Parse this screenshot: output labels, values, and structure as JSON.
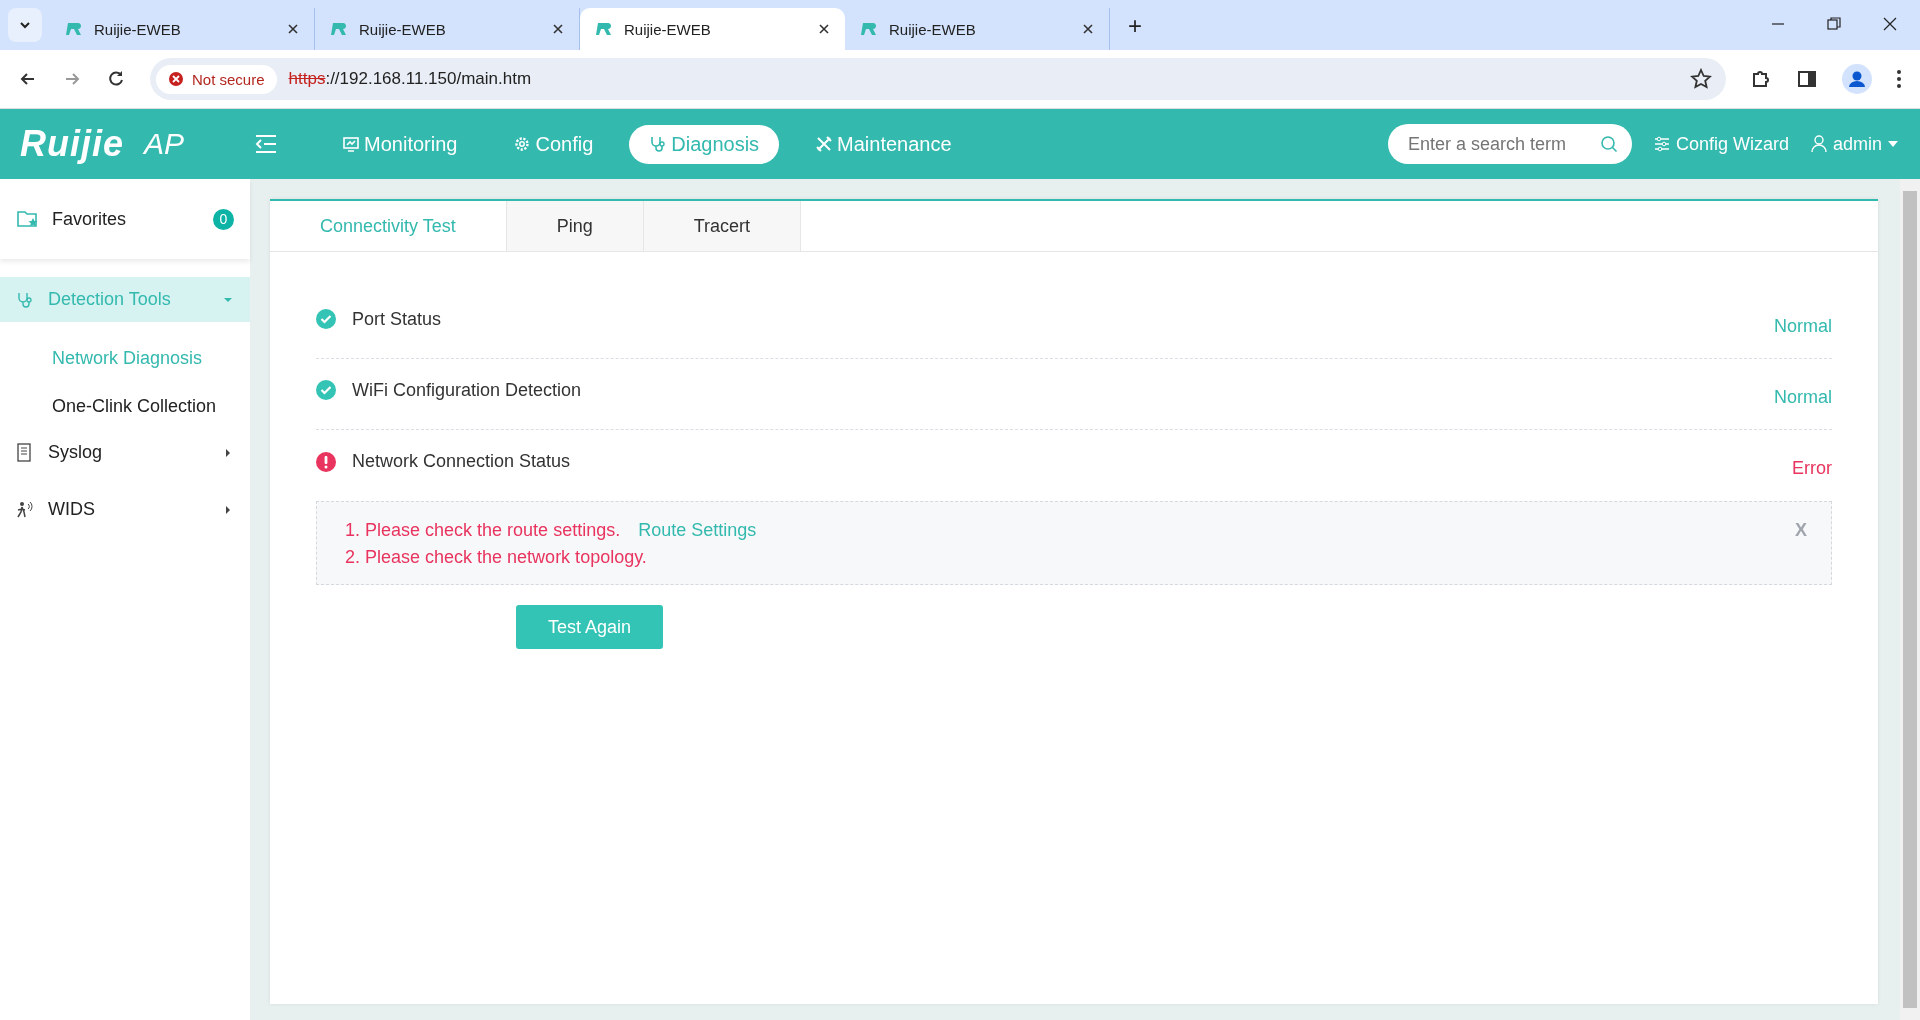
{
  "browser": {
    "tabs": [
      {
        "title": "Ruijie-EWEB",
        "selected": false
      },
      {
        "title": "Ruijie-EWEB",
        "selected": false
      },
      {
        "title": "Ruijie-EWEB",
        "selected": true
      },
      {
        "title": "Ruijie-EWEB",
        "selected": false
      }
    ],
    "new_tab": "+",
    "security": "Not secure",
    "url_scheme": "https",
    "url_rest": "://192.168.11.150/main.htm"
  },
  "header": {
    "logo": "Ruijie",
    "product": "AP",
    "nav": [
      {
        "label": "Monitoring",
        "kind": "monitor",
        "selected": false
      },
      {
        "label": "Config",
        "kind": "gear",
        "selected": false
      },
      {
        "label": "Diagnosis",
        "kind": "stethoscope",
        "selected": true
      },
      {
        "label": "Maintenance",
        "kind": "tools",
        "selected": false
      }
    ],
    "search": {
      "placeholder": "Enter a search term"
    },
    "wizard": "Config Wizard",
    "user": "admin"
  },
  "sidebar": {
    "favorites": {
      "label": "Favorites",
      "count": "0"
    },
    "items": [
      {
        "label": "Detection Tools",
        "kind": "stethoscope",
        "expanded": true,
        "selected": true,
        "children": [
          {
            "label": "Network Diagnosis",
            "selected": true
          },
          {
            "label": "One-Clink Collection",
            "selected": false
          }
        ]
      },
      {
        "label": "Syslog",
        "kind": "log",
        "expanded": false,
        "selected": false
      },
      {
        "label": "WIDS",
        "kind": "person",
        "expanded": false,
        "selected": false
      }
    ]
  },
  "tabs": [
    {
      "label": "Connectivity Test",
      "selected": true
    },
    {
      "label": "Ping",
      "selected": false
    },
    {
      "label": "Tracert",
      "selected": false
    }
  ],
  "checks": [
    {
      "name": "Port Status",
      "kind": "ok",
      "result": "Normal"
    },
    {
      "name": "WiFi Configuration Detection",
      "kind": "ok",
      "result": "Normal"
    },
    {
      "name": "Network Connection Status",
      "kind": "error",
      "result": "Error"
    }
  ],
  "error_box": {
    "lines": [
      {
        "text": "1. Please check the route settings.",
        "link": "Route Settings"
      },
      {
        "text": "2. Please check the network topology."
      }
    ],
    "close": "X"
  },
  "button": "Test Again"
}
